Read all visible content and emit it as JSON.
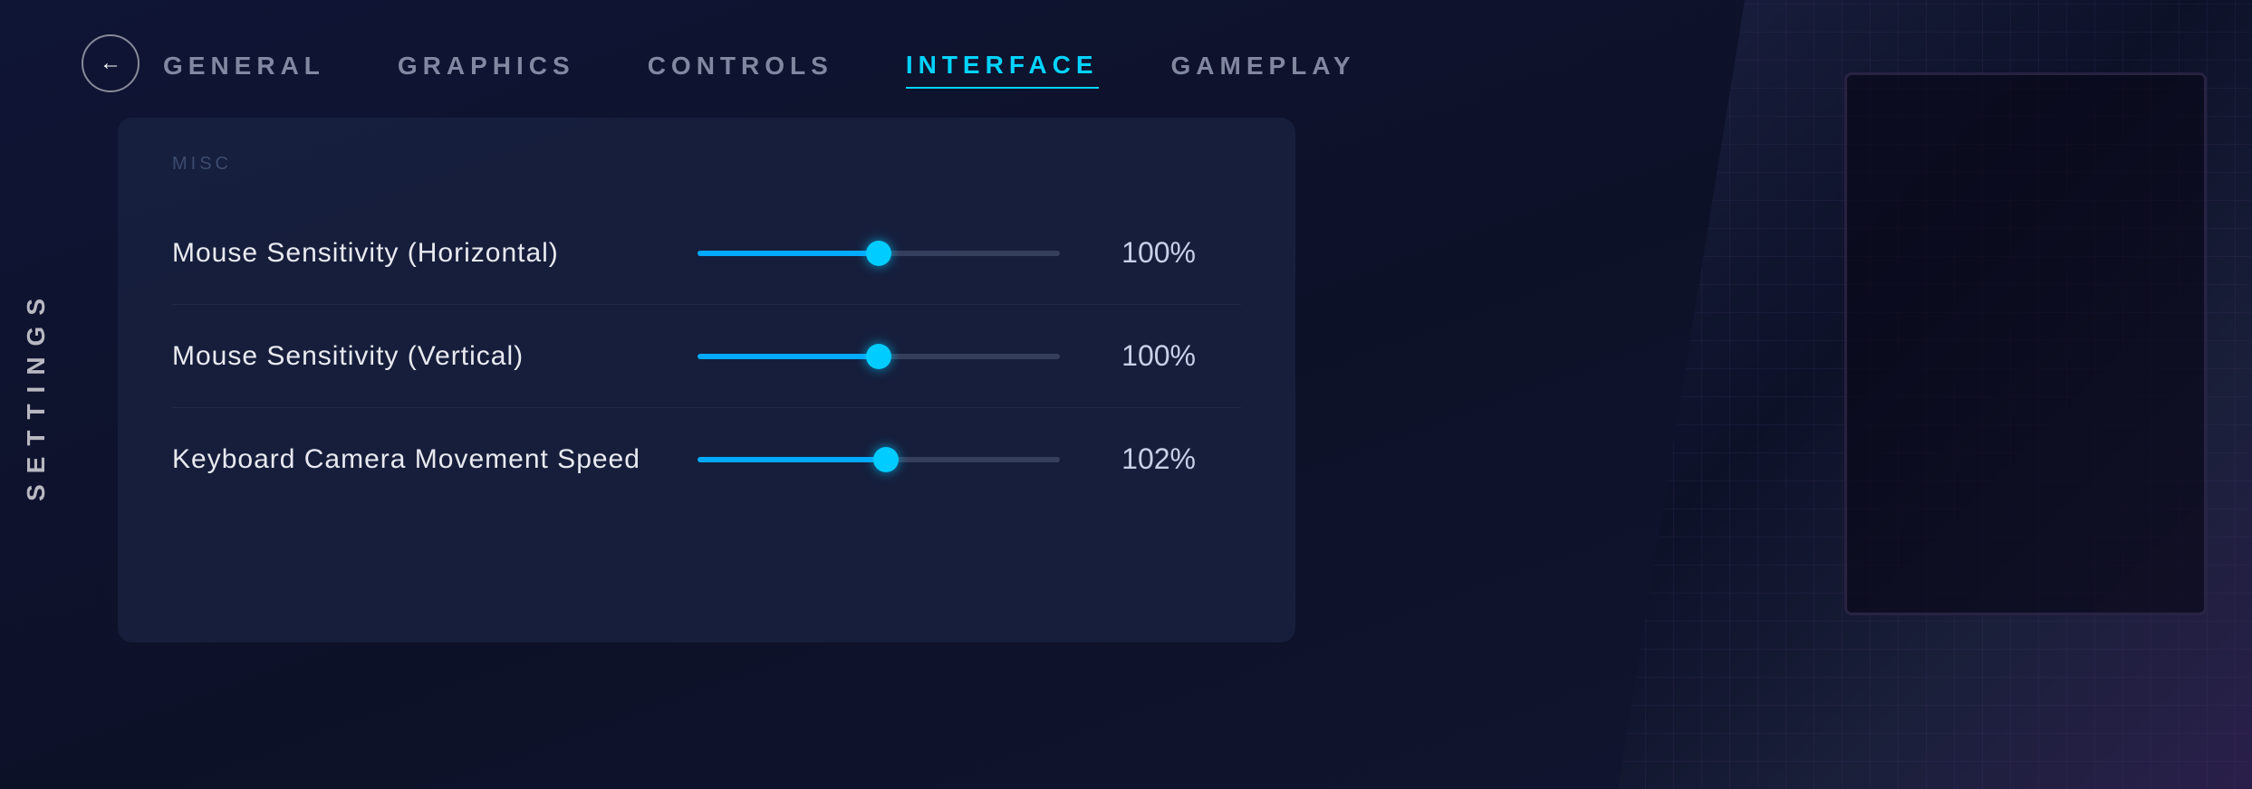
{
  "sidebar": {
    "label": "SETTINGS"
  },
  "back_button": {
    "icon": "←",
    "label": "Back"
  },
  "nav": {
    "tabs": [
      {
        "id": "general",
        "label": "GENERAL",
        "active": false
      },
      {
        "id": "graphics",
        "label": "GRAPHICS",
        "active": false
      },
      {
        "id": "controls",
        "label": "CONTROLS",
        "active": false
      },
      {
        "id": "interface",
        "label": "INTERFACE",
        "active": true
      },
      {
        "id": "gameplay",
        "label": "GAMEPLAY",
        "active": false
      }
    ]
  },
  "content": {
    "section_title": "MISC",
    "settings": [
      {
        "id": "mouse-horizontal",
        "label": "Mouse Sensitivity (Horizontal)",
        "value_display": "100%",
        "value_percent": 50
      },
      {
        "id": "mouse-vertical",
        "label": "Mouse Sensitivity (Vertical)",
        "value_display": "100%",
        "value_percent": 50
      },
      {
        "id": "keyboard-camera",
        "label": "Keyboard Camera Movement Speed",
        "value_display": "102%",
        "value_percent": 52
      }
    ]
  },
  "colors": {
    "accent": "#00ccff",
    "active_tab": "#00d4ff",
    "panel_bg": "rgba(25,35,65,0.75)",
    "bg_dark": "#0d1128"
  }
}
